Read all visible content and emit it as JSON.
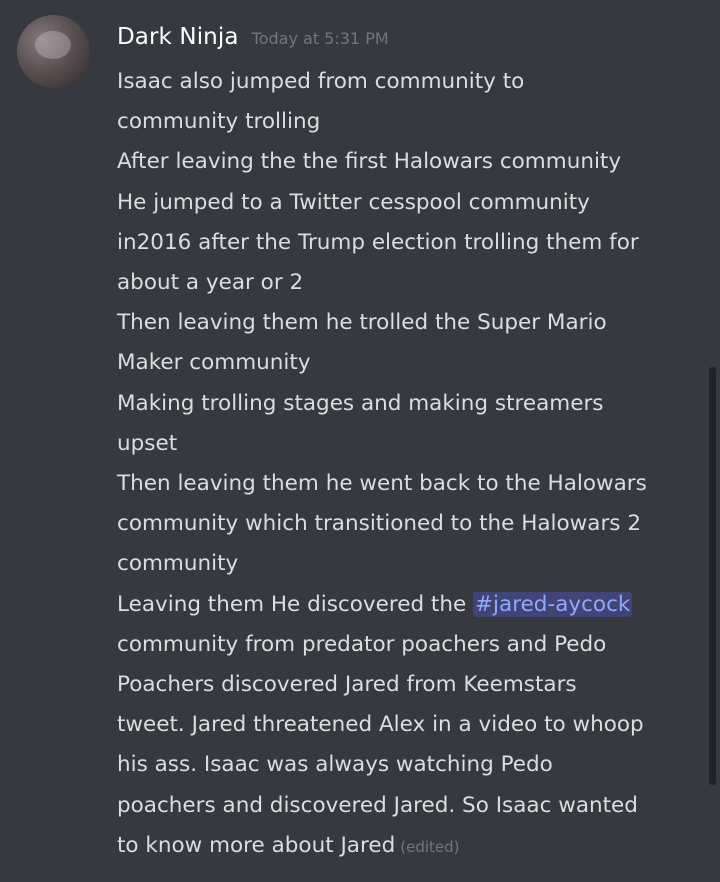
{
  "message": {
    "username": "Dark Ninja",
    "timestamp": "Today at 5:31 PM",
    "avatar_icon": "avatar-photo",
    "lines": [
      "Isaac also jumped from community to",
      "community trolling",
      "After leaving the the first Halowars community",
      "He jumped to a Twitter cesspool community",
      "in2016 after the Trump election trolling them for",
      "about a year or 2",
      "Then leaving them he trolled the Super Mario",
      "Maker community",
      "Making trolling stages and making streamers",
      "upset",
      "Then leaving them he went back to the Halowars",
      "community which transitioned to the Halowars 2",
      "community"
    ],
    "mention_line_prefix": "Leaving them He discovered the ",
    "mention": "#jared-aycock",
    "lines_after": [
      "community from predator poachers and Pedo",
      "Poachers discovered Jared from Keemstars",
      "tweet.  Jared threatened Alex in a video to whoop",
      "his ass. Isaac was always watching Pedo",
      "poachers and discovered Jared. So Isaac wanted"
    ],
    "last_line": "to know more about Jared",
    "edited_label": "(edited)"
  },
  "colors": {
    "background": "#36393f",
    "text": "#dcddde",
    "username": "#ffffff",
    "muted": "#72767d",
    "mention": "#8fa8ff"
  }
}
